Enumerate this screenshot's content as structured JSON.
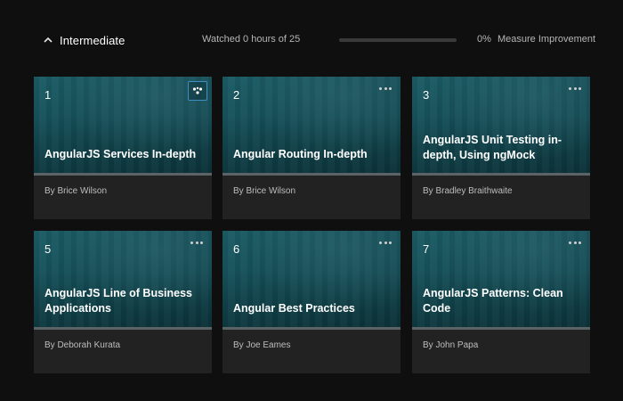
{
  "section": {
    "title": "Intermediate",
    "toggle_icon": "chevron-up-icon"
  },
  "progress": {
    "watched_text": "Watched 0 hours of 25",
    "percent_text": "0%",
    "fraction": 0,
    "measure_label": "Measure Improvement"
  },
  "colors": {
    "card_image": "#155059",
    "card_body": "#222222",
    "active_border": "#3e8fbf"
  },
  "courses": [
    {
      "number": "1",
      "title": "AngularJS Services In-depth",
      "author": "By Brice Wilson",
      "menu_icon": "more-icon"
    },
    {
      "number": "2",
      "title": "Angular Routing In-depth",
      "author": "By Brice Wilson",
      "menu_icon": "more-icon"
    },
    {
      "number": "3",
      "title": "AngularJS Unit Testing in-depth, Using ngMock",
      "author": "By Bradley Braithwaite",
      "menu_icon": "more-icon"
    },
    {
      "number": "5",
      "title": "AngularJS Line of Business Applications",
      "author": "By Deborah Kurata",
      "menu_icon": "more-icon"
    },
    {
      "number": "6",
      "title": "Angular Best Practices",
      "author": "By Joe Eames",
      "menu_icon": "more-icon"
    },
    {
      "number": "7",
      "title": "AngularJS Patterns: Clean Code",
      "author": "By John Papa",
      "menu_icon": "more-icon"
    }
  ]
}
